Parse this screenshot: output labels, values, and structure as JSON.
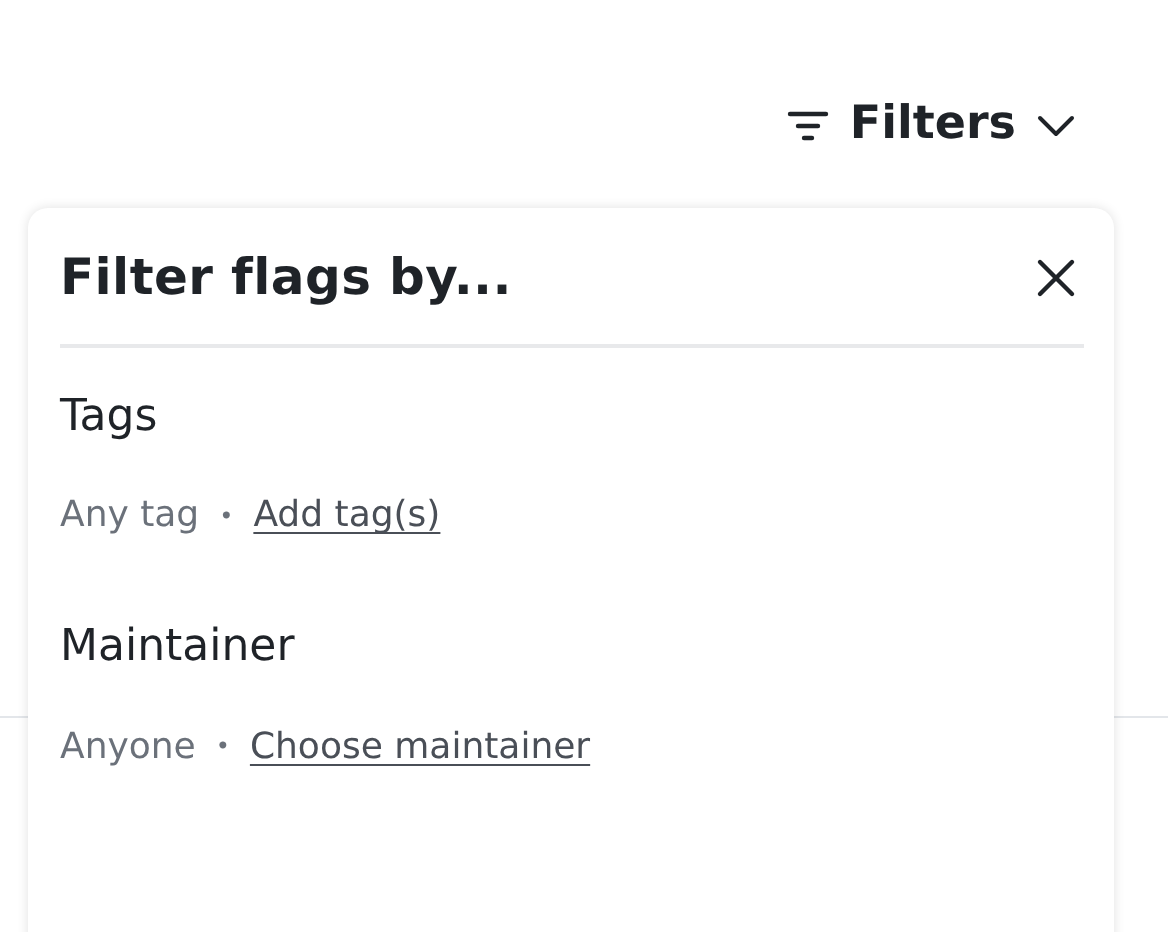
{
  "filters_button": {
    "label": "Filters"
  },
  "popover": {
    "title": "Filter flags by...",
    "sections": [
      {
        "heading": "Tags",
        "value": "Any tag",
        "separator": "•",
        "link": "Add tag(s)"
      },
      {
        "heading": "Maintainer",
        "value": "Anyone",
        "separator": "•",
        "link": "Choose maintainer"
      }
    ]
  }
}
